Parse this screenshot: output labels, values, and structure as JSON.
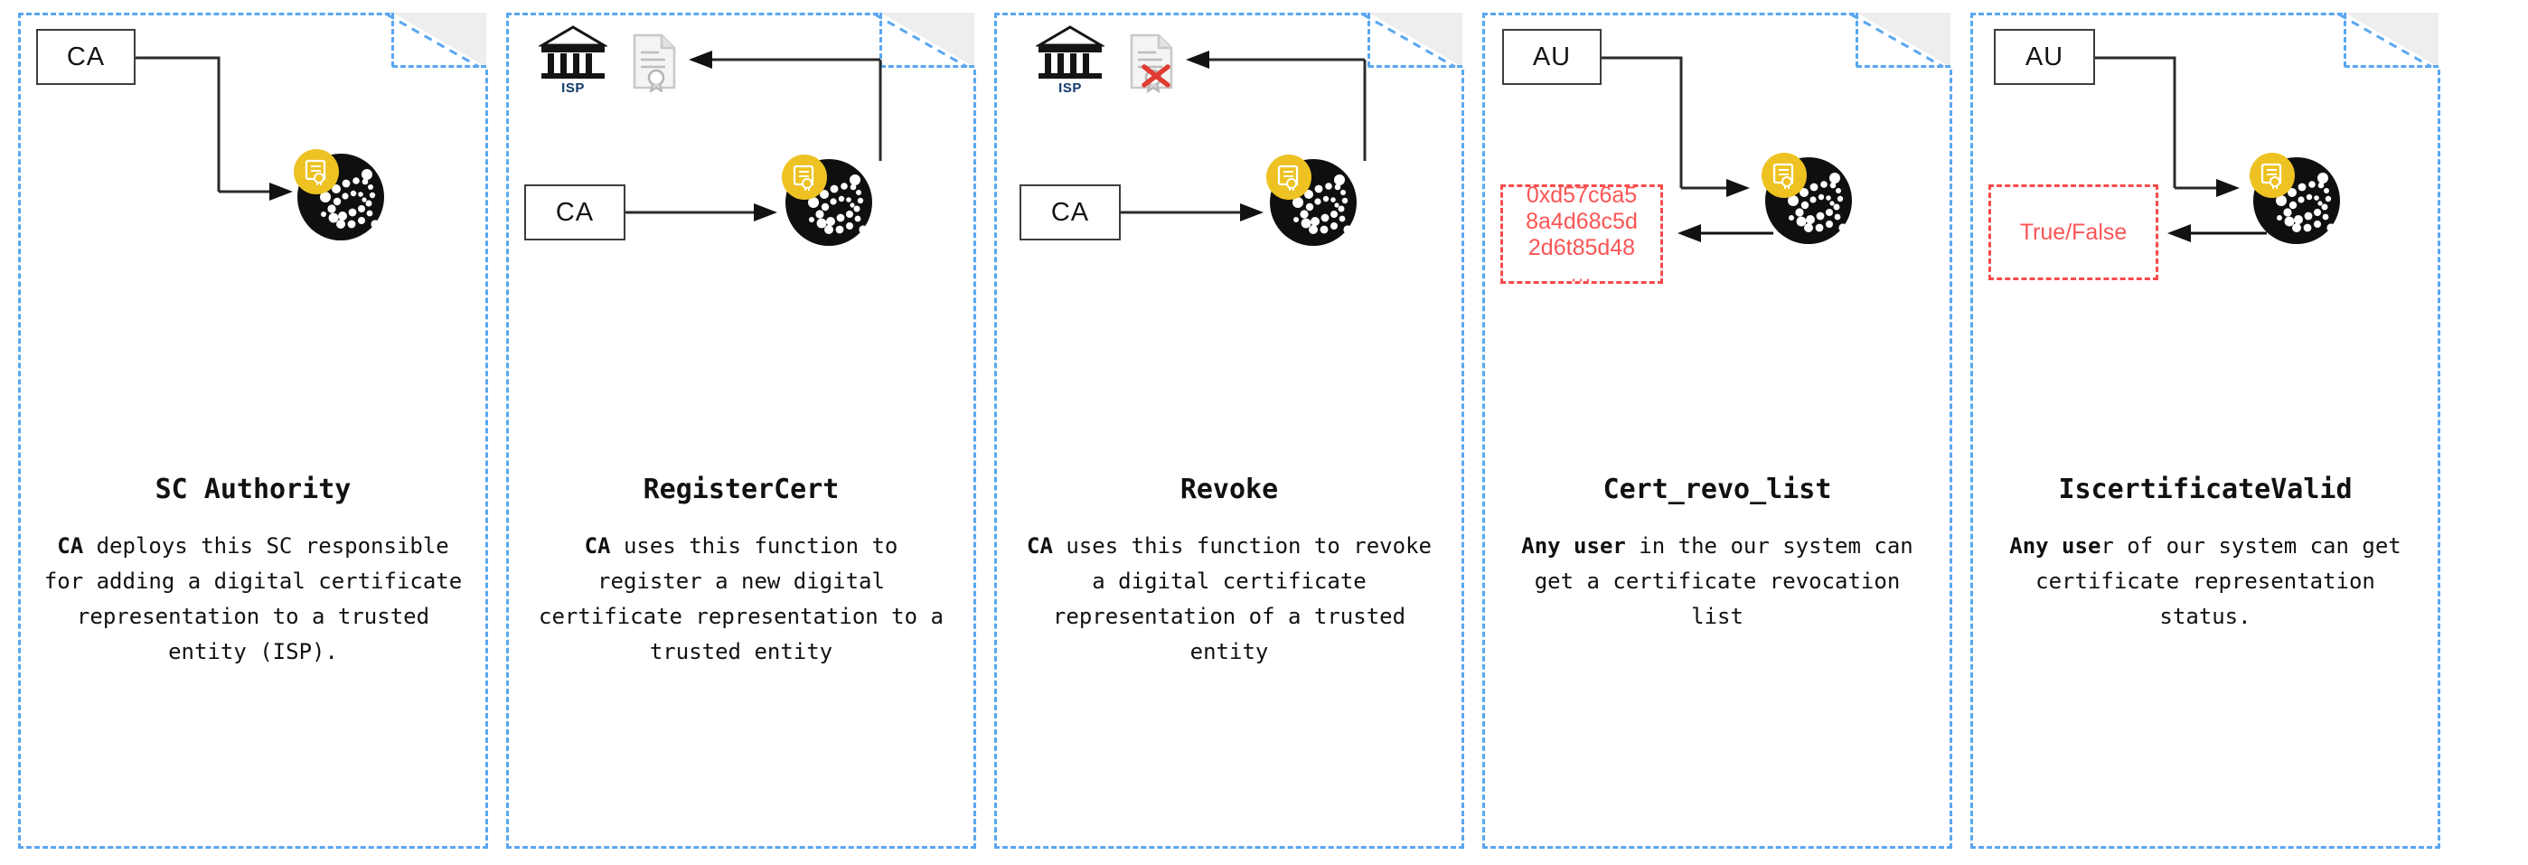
{
  "diagram": {
    "title_semantic": "smart-contract-functions-overview",
    "colors": {
      "panel_border": "#5aa7f0",
      "fold_fill": "#eeeeee",
      "entity_border": "#3d3d3d",
      "iota_black": "#0f0f0f",
      "iota_yellow": "#edc222",
      "output_red": "#fa4b4b",
      "isp_label_blue": "#123a6b",
      "arrow": "#2b2b2b",
      "revoke_x_red": "#e03c31"
    }
  },
  "panels": [
    {
      "id": "sc-authority",
      "entity": {
        "label": "CA"
      },
      "title": "SC Authority",
      "desc_bold": "CA",
      "desc_rest": " deploys this SC responsible for adding a digital certificate representation to a trusted entity (ISP).",
      "has_isp": false,
      "has_certdoc": false,
      "certdoc_revoked": false,
      "output_box": null
    },
    {
      "id": "register-cert",
      "entity": {
        "label": "CA"
      },
      "isp_label": "ISP",
      "title": "RegisterCert",
      "desc_bold": "CA",
      "desc_rest": " uses this function to register a new digital certificate representation to a trusted entity",
      "has_isp": true,
      "has_certdoc": true,
      "certdoc_revoked": false,
      "output_box": null
    },
    {
      "id": "revoke",
      "entity": {
        "label": "CA"
      },
      "isp_label": "ISP",
      "title": "Revoke",
      "desc_bold": "CA",
      "desc_rest": " uses this function to revoke a digital certificate representation of a trusted entity",
      "has_isp": true,
      "has_certdoc": true,
      "certdoc_revoked": true,
      "output_box": null
    },
    {
      "id": "cert-revo-list",
      "entity": {
        "label": "AU"
      },
      "title": "Cert_revo_list",
      "desc_bold": "Any user",
      "desc_rest": " in the our system can get a certificate revocation list",
      "has_isp": false,
      "has_certdoc": false,
      "certdoc_revoked": false,
      "output_box": {
        "lines": [
          "0xd57c6a5",
          "8a4d68c5d",
          "2d6t85d48"
        ],
        "ellipsis": "..."
      }
    },
    {
      "id": "iscertificatevalid",
      "entity": {
        "label": "AU"
      },
      "title": "IscertificateValid",
      "desc_bold": "Any use",
      "desc_rest": "r of our system can get certificate representation status.",
      "has_isp": false,
      "has_certdoc": false,
      "certdoc_revoked": false,
      "output_box": {
        "lines": [
          "True/False"
        ],
        "ellipsis": ""
      }
    }
  ],
  "icons": {
    "iota": "iota-logo-icon",
    "cert_badge": "certificate-badge-icon",
    "bank": "bank-institution-icon",
    "document": "certificate-document-icon",
    "revoked": "red-x-icon",
    "arrow": "arrow-icon",
    "fold": "page-fold-icon"
  }
}
